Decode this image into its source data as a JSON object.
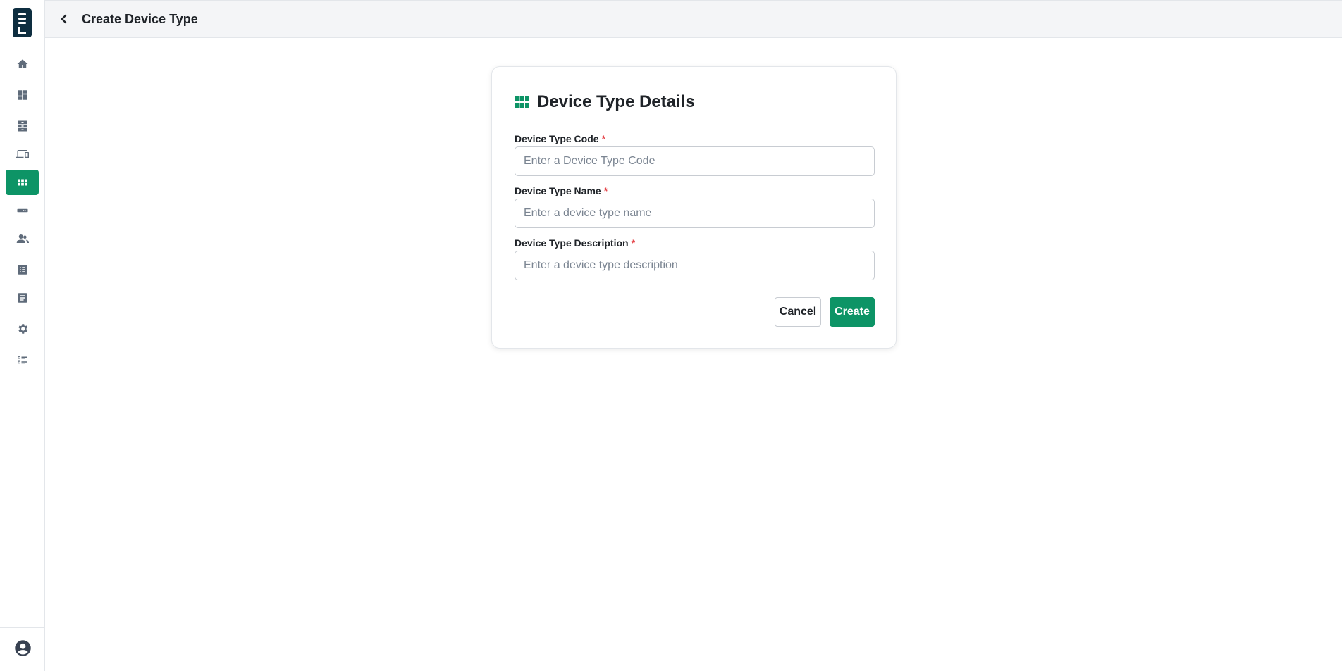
{
  "header": {
    "title": "Create Device Type",
    "back_icon": "chevron-left-icon"
  },
  "sidebar": {
    "logo_icon": "app-logo-icon",
    "items": [
      {
        "name": "home",
        "icon": "home-icon",
        "active": false
      },
      {
        "name": "dashboard",
        "icon": "dashboard-icon",
        "active": false
      },
      {
        "name": "inventory",
        "icon": "cabinet-icon",
        "active": false
      },
      {
        "name": "devices",
        "icon": "devices-icon",
        "active": false
      },
      {
        "name": "device-types",
        "icon": "grid-icon",
        "active": true
      },
      {
        "name": "hardware",
        "icon": "router-icon",
        "active": false
      },
      {
        "name": "users",
        "icon": "users-icon",
        "active": false
      },
      {
        "name": "lists",
        "icon": "list-icon",
        "active": false
      },
      {
        "name": "reports",
        "icon": "document-icon",
        "active": false
      },
      {
        "name": "settings",
        "icon": "gear-icon",
        "active": false
      },
      {
        "name": "checklist",
        "icon": "checklist-icon",
        "active": false
      }
    ],
    "account_icon": "account-circle-icon"
  },
  "card": {
    "title": "Device Type Details",
    "title_icon": "grid-icon",
    "fields": [
      {
        "label": "Device Type Code",
        "required_mark": "*",
        "value": "",
        "placeholder": "Enter a Device Type Code"
      },
      {
        "label": "Device Type Name",
        "required_mark": "*",
        "value": "",
        "placeholder": "Enter a device type name"
      },
      {
        "label": "Device Type Description",
        "required_mark": "*",
        "value": "",
        "placeholder": "Enter a device type description"
      }
    ],
    "cancel_label": "Cancel",
    "create_label": "Create"
  },
  "colors": {
    "accent": "#0d9466",
    "logo_bg": "#0e2e40",
    "required": "#e5484d",
    "header_bg": "#f4f5f7"
  }
}
